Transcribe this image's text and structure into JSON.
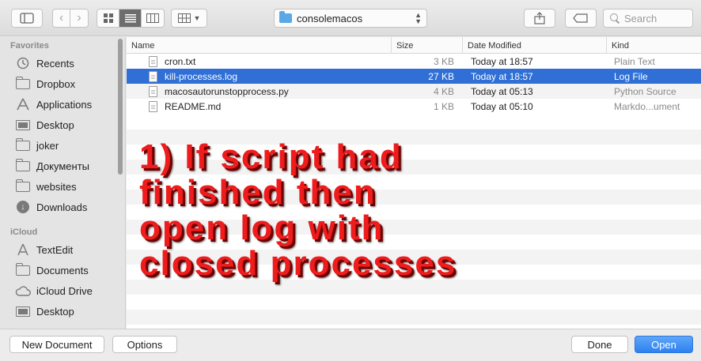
{
  "toolbar": {
    "path_folder": "consolemacos",
    "search_placeholder": "Search"
  },
  "sidebar": {
    "favorites_heading": "Favorites",
    "favorites": [
      {
        "label": "Recents",
        "icon": "recents-icon"
      },
      {
        "label": "Dropbox",
        "icon": "folder-icon"
      },
      {
        "label": "Applications",
        "icon": "applications-icon"
      },
      {
        "label": "Desktop",
        "icon": "desktop-icon"
      },
      {
        "label": "joker",
        "icon": "folder-icon"
      },
      {
        "label": "Документы",
        "icon": "folder-icon"
      },
      {
        "label": "websites",
        "icon": "folder-icon"
      },
      {
        "label": "Downloads",
        "icon": "downloads-icon"
      }
    ],
    "icloud_heading": "iCloud",
    "icloud": [
      {
        "label": "TextEdit",
        "icon": "textedit-icon"
      },
      {
        "label": "Documents",
        "icon": "folder-icon"
      },
      {
        "label": "iCloud Drive",
        "icon": "cloud-icon"
      },
      {
        "label": "Desktop",
        "icon": "desktop-icon"
      }
    ]
  },
  "list": {
    "columns": {
      "name": "Name",
      "size": "Size",
      "date": "Date Modified",
      "kind": "Kind"
    },
    "rows": [
      {
        "name": "cron.txt",
        "size": "3 KB",
        "date": "Today at 18:57",
        "kind": "Plain Text",
        "selected": false
      },
      {
        "name": "kill-processes.log",
        "size": "27 KB",
        "date": "Today at 18:57",
        "kind": "Log File",
        "selected": true
      },
      {
        "name": "macosautorunstopprocess.py",
        "size": "4 KB",
        "date": "Today at 05:13",
        "kind": "Python Source",
        "selected": false
      },
      {
        "name": "README.md",
        "size": "1 KB",
        "date": "Today at 05:10",
        "kind": "Markdo...ument",
        "selected": false
      }
    ]
  },
  "annotation": {
    "text": "1) If script had\nfinished then\nopen log with\nclosed processes",
    "color": "#ee1c1c"
  },
  "buttons": {
    "new_document": "New Document",
    "options": "Options",
    "done": "Done",
    "open": "Open"
  },
  "colors": {
    "selection": "#2f6fd6",
    "accent": "#2c81f1"
  }
}
